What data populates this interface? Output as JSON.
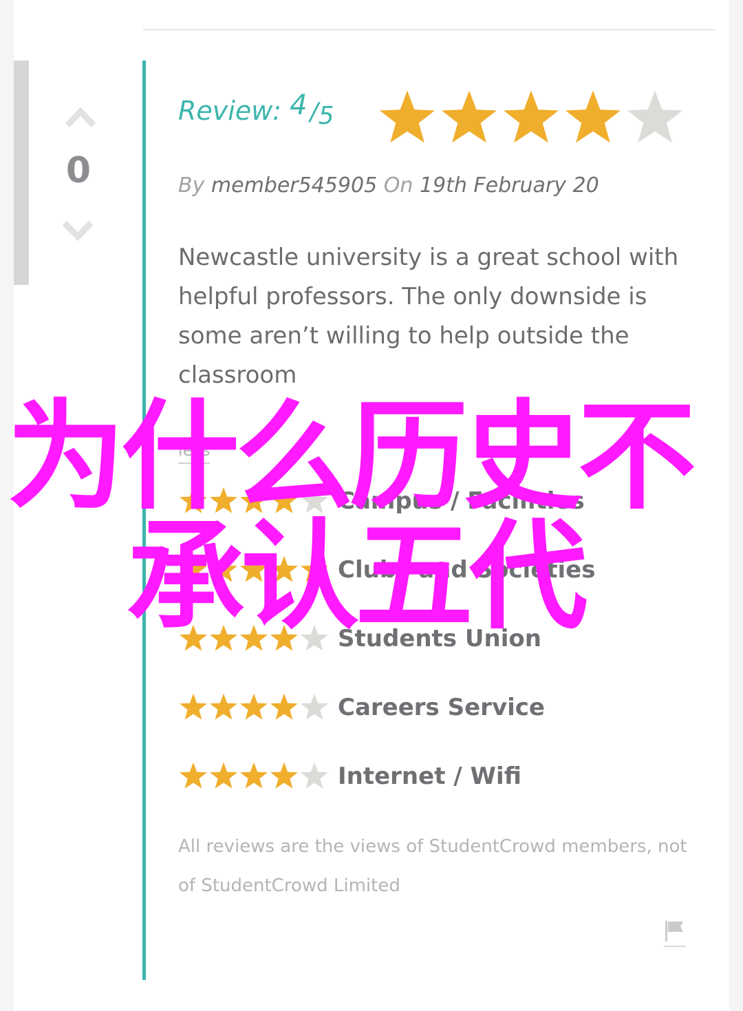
{
  "vote": {
    "count": "0"
  },
  "review": {
    "label": "Review:",
    "score": "4",
    "slash": "/",
    "max": "5",
    "rating": 4,
    "by_label": "By",
    "author": "member545905",
    "on_label": "On",
    "date": "19th February 20",
    "body": "Newcastle university is a great school with helpful professors. The only downside is some aren’t willing to help outside the classroom"
  },
  "read_more_label": "less",
  "categories": [
    {
      "label": "Campus / Facilities",
      "rating": 4
    },
    {
      "label": "Clubs and Societies",
      "rating": 5
    },
    {
      "label": "Students Union",
      "rating": 4
    },
    {
      "label": "Careers Service",
      "rating": 4
    },
    {
      "label": "Internet / Wifi",
      "rating": 4
    }
  ],
  "disclaimer": "All reviews are the views of StudentCrowd members, not of StudentCrowd Limited",
  "overlay": {
    "line1": "为什么历史不",
    "line2": "承认五代"
  },
  "colors": {
    "accent": "#3cb5ad",
    "star_filled": "#f0ae2d",
    "star_empty": "#dcdbd8",
    "overlay_text": "#ff1aff"
  },
  "icons": {
    "upvote": "chevron-up-icon",
    "downvote": "chevron-down-icon",
    "star": "star-icon",
    "flag": "flag-icon"
  }
}
